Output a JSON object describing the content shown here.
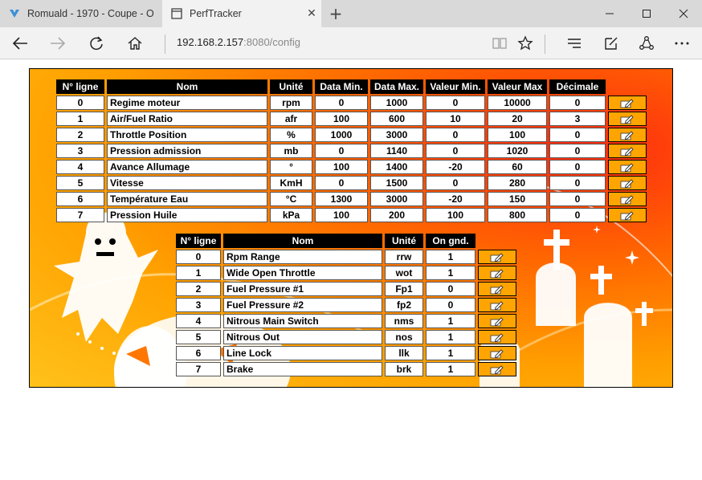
{
  "browser": {
    "tabs": [
      {
        "title": "Romuald - 1970 - Coupe - O",
        "active": false
      },
      {
        "title": "PerfTracker",
        "active": true
      }
    ],
    "address": {
      "host": "192.168.2.157",
      "port_path": ":8080/config"
    }
  },
  "colors": {
    "header_bg": "#000000",
    "edit_button": "#ffa400",
    "accent": "#ff6a00"
  },
  "config_table": {
    "headers": [
      "N° ligne",
      "Nom",
      "Unité",
      "Data Min.",
      "Data Max.",
      "Valeur Min.",
      "Valeur Max",
      "Décimale"
    ],
    "rows": [
      {
        "n": "0",
        "nom": "Regime moteur",
        "unite": "rpm",
        "data_min": "0",
        "data_max": "1000",
        "val_min": "0",
        "val_max": "10000",
        "dec": "0"
      },
      {
        "n": "1",
        "nom": "Air/Fuel Ratio",
        "unite": "afr",
        "data_min": "100",
        "data_max": "600",
        "val_min": "10",
        "val_max": "20",
        "dec": "3"
      },
      {
        "n": "2",
        "nom": "Throttle Position",
        "unite": "%",
        "data_min": "1000",
        "data_max": "3000",
        "val_min": "0",
        "val_max": "100",
        "dec": "0"
      },
      {
        "n": "3",
        "nom": "Pression admission",
        "unite": "mb",
        "data_min": "0",
        "data_max": "1140",
        "val_min": "0",
        "val_max": "1020",
        "dec": "0"
      },
      {
        "n": "4",
        "nom": "Avance Allumage",
        "unite": "°",
        "data_min": "100",
        "data_max": "1400",
        "val_min": "-20",
        "val_max": "60",
        "dec": "0"
      },
      {
        "n": "5",
        "nom": "Vitesse",
        "unite": "KmH",
        "data_min": "0",
        "data_max": "1500",
        "val_min": "0",
        "val_max": "280",
        "dec": "0"
      },
      {
        "n": "6",
        "nom": "Température Eau",
        "unite": "°C",
        "data_min": "1300",
        "data_max": "3000",
        "val_min": "-20",
        "val_max": "150",
        "dec": "0"
      },
      {
        "n": "7",
        "nom": "Pression Huile",
        "unite": "kPa",
        "data_min": "100",
        "data_max": "200",
        "val_min": "100",
        "val_max": "800",
        "dec": "0"
      }
    ]
  },
  "switch_table": {
    "headers": [
      "N° ligne",
      "Nom",
      "Unité",
      "On gnd."
    ],
    "rows": [
      {
        "n": "0",
        "nom": "Rpm Range",
        "unite": "rrw",
        "on_gnd": "1"
      },
      {
        "n": "1",
        "nom": "Wide Open Throttle",
        "unite": "wot",
        "on_gnd": "1"
      },
      {
        "n": "2",
        "nom": "Fuel Pressure #1",
        "unite": "Fp1",
        "on_gnd": "0"
      },
      {
        "n": "3",
        "nom": "Fuel Pressure #2",
        "unite": "fp2",
        "on_gnd": "0"
      },
      {
        "n": "4",
        "nom": "Nitrous Main Switch",
        "unite": "nms",
        "on_gnd": "1"
      },
      {
        "n": "5",
        "nom": "Nitrous Out",
        "unite": "nos",
        "on_gnd": "1"
      },
      {
        "n": "6",
        "nom": "Line Lock",
        "unite": "llk",
        "on_gnd": "1"
      },
      {
        "n": "7",
        "nom": "Brake",
        "unite": "brk",
        "on_gnd": "1"
      }
    ]
  }
}
